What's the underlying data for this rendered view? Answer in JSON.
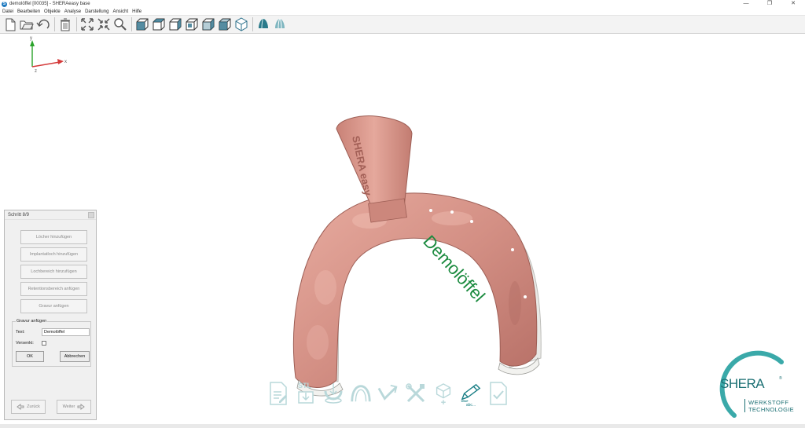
{
  "window": {
    "title": "demolöffel [00035] - SHERAeasy base",
    "app_icon_letter": "S",
    "minimize_glyph": "—",
    "restore_glyph": "❐",
    "close_glyph": "✕"
  },
  "menu": [
    "Datei",
    "Bearbeiten",
    "Objekte",
    "Analyse",
    "Darstellung",
    "Ansicht",
    "Hilfe"
  ],
  "toolbar": {
    "groups": [
      [
        "new-file-icon",
        "open-folder-icon",
        "undo-icon"
      ],
      [
        "delete-icon"
      ],
      [
        "fit-view-icon",
        "zoom-extents-icon",
        "zoom-icon"
      ],
      [
        "view-front-icon",
        "view-back-icon",
        "view-left-icon",
        "view-right-icon",
        "view-top-icon",
        "view-bottom-icon",
        "view-iso-icon"
      ],
      [
        "shade-mode-1-icon",
        "shade-mode-2-icon"
      ]
    ]
  },
  "axis": {
    "x": "x",
    "y": "y",
    "z": "z"
  },
  "model": {
    "engraving_text": "Demolöffel",
    "handle_text": "SHERA easy",
    "color_body": "#d79489",
    "color_engraving": "#1a8a3e"
  },
  "panel": {
    "title": "Schritt 8/9",
    "steps": [
      "Löcher hinzufügen",
      "Implantatloch hinzufügen",
      "Lochbereich hinzufügen",
      "Retentionsbereich anfügen",
      "Gravur anfügen"
    ],
    "group_title": "Gravur anfügen",
    "text_label": "Text:",
    "text_value": "Demolöffel",
    "versenkt_label": "Versenkt:",
    "ok_label": "OK",
    "cancel_label": "Abbrechen",
    "back_label": "Zurück",
    "next_label": "Weiter"
  },
  "workflow": {
    "steps": [
      "edit-document-icon",
      "stl-download-icon",
      "scan-import-icon",
      "arch-outline-icon",
      "handle-icon",
      "tools-icon",
      "block-add-icon",
      "engrave-icon",
      "check-document-icon"
    ],
    "stl_caption": "STL",
    "engrave_caption": "abc...",
    "active_color": "#1b7f86",
    "inactive_color": "#b9d8da"
  },
  "logo": {
    "word": "SHERA",
    "reg": "®",
    "line1": "WERKSTOFF",
    "line2": "TECHNOLOGIE",
    "color": "#1b6f73"
  }
}
